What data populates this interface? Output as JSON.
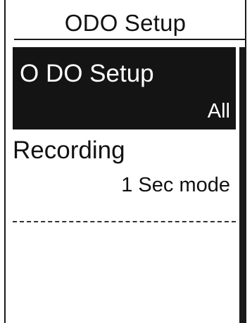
{
  "screen": {
    "title": "ODO Setup"
  },
  "menu": {
    "items": [
      {
        "label": "O DO Setup",
        "value": "All",
        "selected": true
      },
      {
        "label": "Recording",
        "value": "1 Sec mode",
        "selected": false
      }
    ]
  },
  "colors": {
    "background": "#ffffff",
    "foreground": "#111111",
    "selection": "#141414"
  }
}
